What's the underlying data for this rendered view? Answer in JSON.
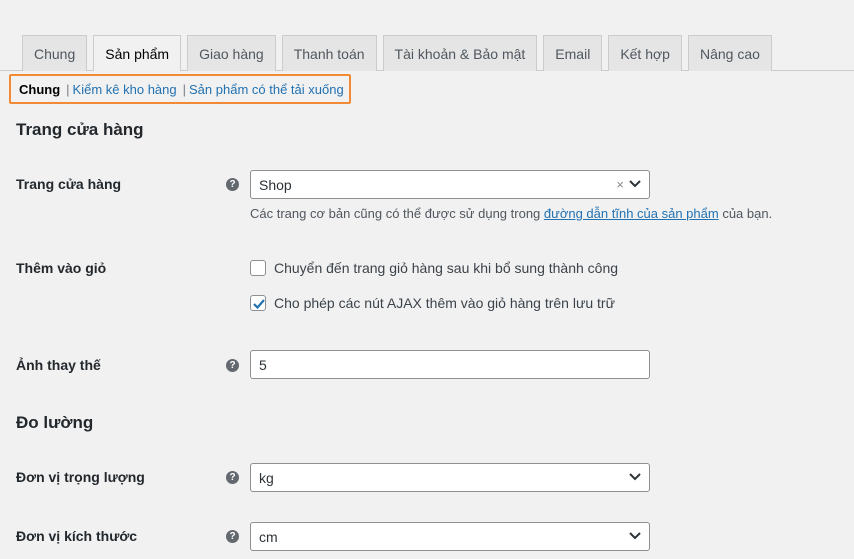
{
  "tabs": [
    {
      "label": "Chung",
      "active": false
    },
    {
      "label": "Sản phẩm",
      "active": true
    },
    {
      "label": "Giao hàng",
      "active": false
    },
    {
      "label": "Thanh toán",
      "active": false
    },
    {
      "label": "Tài khoản & Bảo mật",
      "active": false
    },
    {
      "label": "Email",
      "active": false
    },
    {
      "label": "Kết hợp",
      "active": false
    },
    {
      "label": "Nâng cao",
      "active": false
    }
  ],
  "subnav": {
    "current": "Chung",
    "links": [
      "Kiểm kê kho hàng",
      "Sản phẩm có thể tải xuống"
    ],
    "separator": "|"
  },
  "shop_section": {
    "title": "Trang cửa hàng",
    "shop_page": {
      "label": "Trang cửa hàng",
      "help_icon": "?",
      "value": "Shop",
      "clear_icon": "×",
      "desc_before": "Các trang cơ bản cũng có thể được sử dụng trong ",
      "desc_link": "đường dẫn tĩnh của sản phẩm",
      "desc_after": " của bạn."
    },
    "add_to_cart": {
      "label": "Thêm vào giỏ",
      "options": [
        {
          "label": "Chuyển đến trang giỏ hàng sau khi bổ sung thành công",
          "checked": false
        },
        {
          "label": "Cho phép các nút AJAX thêm vào giỏ hàng trên lưu trữ",
          "checked": true
        }
      ]
    },
    "placeholder_image": {
      "label": "Ảnh thay thế",
      "help_icon": "?",
      "value": "5"
    }
  },
  "measurements": {
    "title": "Đo lường",
    "weight": {
      "label": "Đơn vị trọng lượng",
      "help_icon": "?",
      "value": "kg"
    },
    "dimensions": {
      "label": "Đơn vị kích thước",
      "help_icon": "?",
      "value": "cm"
    }
  },
  "colors": {
    "accent": "#2271b1",
    "highlight_border": "#f08a36",
    "checkbox_check": "#2271b1"
  }
}
